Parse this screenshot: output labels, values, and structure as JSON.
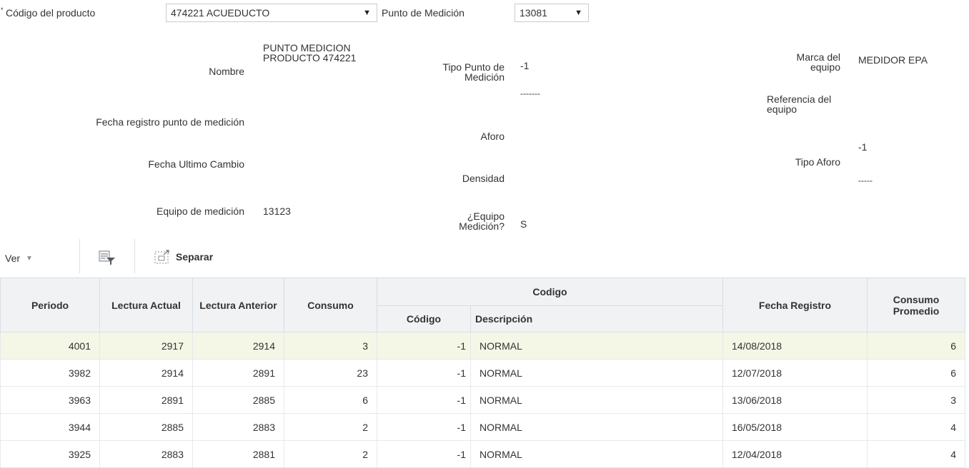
{
  "header": {
    "required_marker": "*",
    "product_label": "Código del producto",
    "product_value": "474221 ACUEDUCTO",
    "point_label": "Punto de Medición",
    "point_value": "13081"
  },
  "details": {
    "nombre_label": "Nombre",
    "nombre_value": "PUNTO MEDICION PRODUCTO 474221",
    "fecha_registro_label": "Fecha registro punto de medición",
    "fecha_registro_value": "",
    "fecha_cambio_label": "Fecha Ultimo Cambio",
    "fecha_cambio_value": "",
    "equipo_label": "Equipo de medición",
    "equipo_value": "13123",
    "tipo_punto_label": "Tipo Punto de Medición",
    "tipo_punto_value": "-1",
    "tipo_punto_desc": "-------",
    "aforo_label": "Aforo",
    "aforo_value": "",
    "densidad_label": "Densidad",
    "densidad_value": "",
    "equipo_medicion_q_label": "¿Equipo Medición?",
    "equipo_medicion_q_value": "S",
    "marca_label": "Marca del equipo",
    "marca_value": "MEDIDOR EPA",
    "referencia_label": "Referencia del equipo",
    "referencia_value": "",
    "tipo_aforo_label": "Tipo Aforo",
    "tipo_aforo_value": "-1",
    "tipo_aforo_desc": "-----"
  },
  "toolbar": {
    "view_label": "Ver",
    "detach_label": "Separar",
    "icons": [
      "chevron-down-icon",
      "query-by-example-icon",
      "detach-icon"
    ]
  },
  "table": {
    "headers": {
      "periodo": "Periodo",
      "lectura_actual": "Lectura Actual",
      "lectura_anterior": "Lectura Anterior",
      "consumo": "Consumo",
      "codigo_group": "Codigo",
      "codigo": "Código",
      "descripcion": "Descripción",
      "fecha_registro": "Fecha Registro",
      "consumo_promedio": "Consumo Promedio"
    },
    "rows": [
      {
        "periodo": "4001",
        "actual": "2917",
        "anterior": "2914",
        "consumo": "3",
        "codigo": "-1",
        "descripcion": "NORMAL",
        "fecha": "14/08/2018",
        "promedio": "6"
      },
      {
        "periodo": "3982",
        "actual": "2914",
        "anterior": "2891",
        "consumo": "23",
        "codigo": "-1",
        "descripcion": "NORMAL",
        "fecha": "12/07/2018",
        "promedio": "6"
      },
      {
        "periodo": "3963",
        "actual": "2891",
        "anterior": "2885",
        "consumo": "6",
        "codigo": "-1",
        "descripcion": "NORMAL",
        "fecha": "13/06/2018",
        "promedio": "3"
      },
      {
        "periodo": "3944",
        "actual": "2885",
        "anterior": "2883",
        "consumo": "2",
        "codigo": "-1",
        "descripcion": "NORMAL",
        "fecha": "16/05/2018",
        "promedio": "4"
      },
      {
        "periodo": "3925",
        "actual": "2883",
        "anterior": "2881",
        "consumo": "2",
        "codigo": "-1",
        "descripcion": "NORMAL",
        "fecha": "12/04/2018",
        "promedio": "4"
      }
    ]
  }
}
